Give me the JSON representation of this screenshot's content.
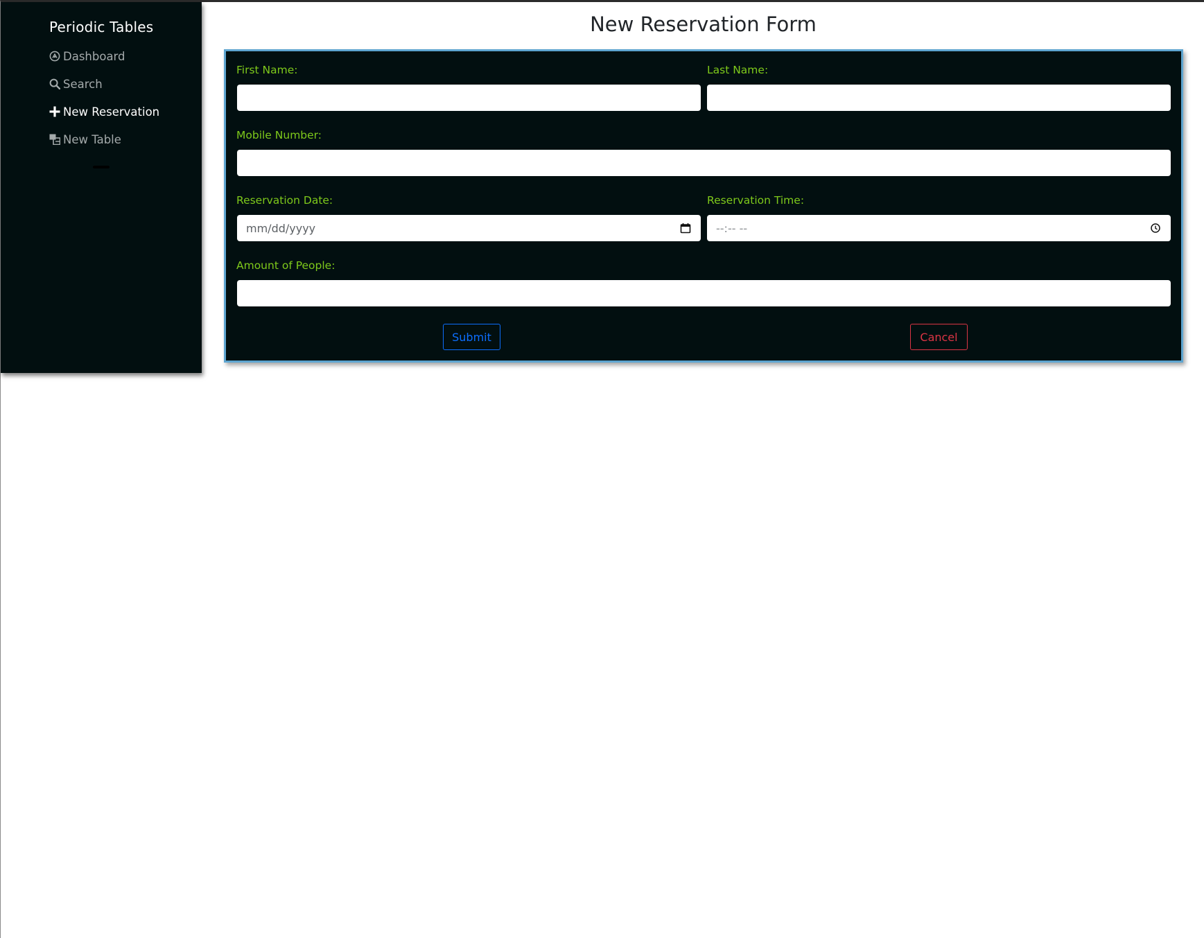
{
  "sidebar": {
    "brand": "Periodic Tables",
    "items": [
      {
        "label": "Dashboard",
        "icon": "dashboard-icon"
      },
      {
        "label": "Search",
        "icon": "search-icon"
      },
      {
        "label": "New Reservation",
        "icon": "plus-icon",
        "active": true
      },
      {
        "label": "New Table",
        "icon": "table-icon"
      }
    ]
  },
  "main": {
    "title": "New Reservation Form"
  },
  "form": {
    "first_name_label": "First Name:",
    "last_name_label": "Last Name:",
    "mobile_label": "Mobile Number:",
    "date_label": "Reservation Date:",
    "date_placeholder": "mm/dd/yyyy",
    "time_label": "Reservation Time:",
    "time_placeholder": "--:-- --",
    "people_label": "Amount of People:",
    "submit_label": "Submit",
    "cancel_label": "Cancel"
  },
  "colors": {
    "sidebar_bg": "#020f10",
    "label_green": "#7ec91b",
    "card_border": "#5fa6d1",
    "submit_blue": "#0d6efd",
    "cancel_red": "#dc3545"
  }
}
